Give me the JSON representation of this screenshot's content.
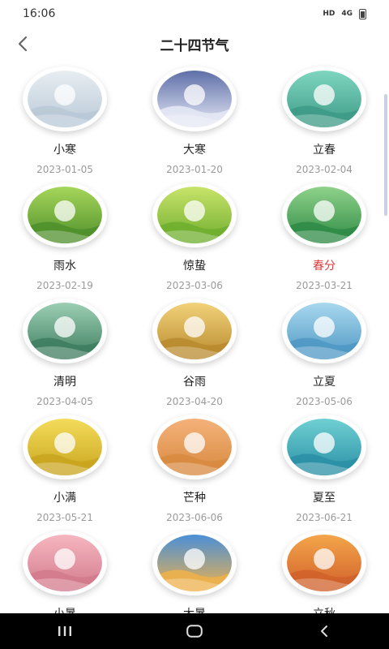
{
  "status": {
    "time": "16:06",
    "network": "HD",
    "signal": "4G"
  },
  "header": {
    "title": "二十四节气"
  },
  "terms": [
    {
      "name": "小寒",
      "date": "2023-01-05",
      "highlight": false,
      "icon": "winter-snow-fence-icon",
      "colors": [
        "#e8eef2",
        "#b8c8d6"
      ]
    },
    {
      "name": "大寒",
      "date": "2023-01-20",
      "highlight": false,
      "icon": "winter-house-lanterns-icon",
      "colors": [
        "#5e6fa8",
        "#e6e9f5"
      ]
    },
    {
      "name": "立春",
      "date": "2023-02-04",
      "highlight": false,
      "icon": "spring-green-hills-icon",
      "colors": [
        "#7fd6c0",
        "#3d9a86"
      ]
    },
    {
      "name": "雨水",
      "date": "2023-02-19",
      "highlight": false,
      "icon": "rain-leaf-frog-icon",
      "colors": [
        "#a6d65a",
        "#4f8f2b"
      ]
    },
    {
      "name": "惊蛰",
      "date": "2023-03-06",
      "highlight": false,
      "icon": "thunder-tree-icon",
      "colors": [
        "#c8e36a",
        "#6fae2e"
      ]
    },
    {
      "name": "春分",
      "date": "2023-03-21",
      "highlight": true,
      "icon": "spring-swallow-icon",
      "colors": [
        "#8fd28a",
        "#2e8a45"
      ]
    },
    {
      "name": "清明",
      "date": "2023-04-05",
      "highlight": false,
      "icon": "rain-buffalo-icon",
      "colors": [
        "#9ccfb4",
        "#3e7d5f"
      ]
    },
    {
      "name": "谷雨",
      "date": "2023-04-20",
      "highlight": false,
      "icon": "wheat-field-icon",
      "colors": [
        "#f2d27a",
        "#b98a2e"
      ]
    },
    {
      "name": "立夏",
      "date": "2023-05-06",
      "highlight": false,
      "icon": "summer-boat-icon",
      "colors": [
        "#a9d8ee",
        "#4f98c4"
      ]
    },
    {
      "name": "小满",
      "date": "2023-05-21",
      "highlight": false,
      "icon": "golden-grain-icon",
      "colors": [
        "#f3dc5a",
        "#c9a51f"
      ]
    },
    {
      "name": "芒种",
      "date": "2023-06-06",
      "highlight": false,
      "icon": "harvest-field-icon",
      "colors": [
        "#f4b27a",
        "#d8893f"
      ]
    },
    {
      "name": "夏至",
      "date": "2023-06-21",
      "highlight": false,
      "icon": "summer-lake-icon",
      "colors": [
        "#6fd0d2",
        "#2a8fa6"
      ]
    },
    {
      "name": "小暑",
      "date": "",
      "highlight": false,
      "icon": "summer-heat-pink-icon",
      "colors": [
        "#f6b6c0",
        "#d27a8c"
      ]
    },
    {
      "name": "大暑",
      "date": "",
      "highlight": false,
      "icon": "summer-swim-icon",
      "colors": [
        "#4a8fd8",
        "#f0b24a"
      ]
    },
    {
      "name": "立秋",
      "date": "",
      "highlight": false,
      "icon": "autumn-maple-icon",
      "colors": [
        "#f4a64a",
        "#d0602a"
      ]
    }
  ],
  "navigation": {
    "recent_icon": "recent-apps-icon",
    "home_icon": "home-icon",
    "back_icon": "back-icon"
  }
}
